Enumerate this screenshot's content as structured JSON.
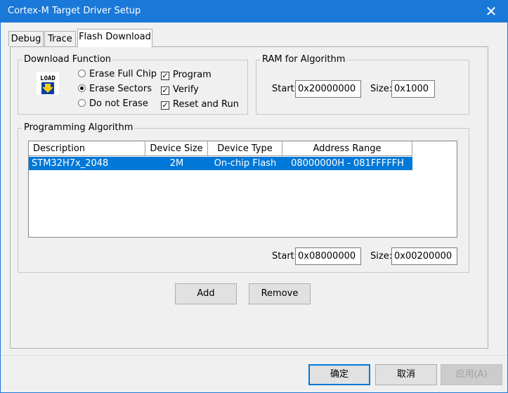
{
  "window": {
    "title": "Cortex-M Target Driver Setup",
    "close_glyph": "✕"
  },
  "tabs": [
    {
      "label": "Debug"
    },
    {
      "label": "Trace"
    },
    {
      "label": "Flash Download"
    }
  ],
  "download_function": {
    "label": "Download Function",
    "icon_text": "LOAD",
    "erase_options": [
      {
        "label": "Erase Full Chip",
        "checked": false
      },
      {
        "label": "Erase Sectors",
        "checked": true
      },
      {
        "label": "Do not Erase",
        "checked": false
      }
    ],
    "checkboxes": [
      {
        "label": "Program",
        "checked": true
      },
      {
        "label": "Verify",
        "checked": true
      },
      {
        "label": "Reset and Run",
        "checked": true
      }
    ]
  },
  "ram": {
    "label": "RAM for Algorithm",
    "start_label": "Start:",
    "start_value": "0x20000000",
    "size_label": "Size:",
    "size_value": "0x1000"
  },
  "programming_algorithm": {
    "label": "Programming Algorithm",
    "columns": [
      "Description",
      "Device Size",
      "Device Type",
      "Address Range"
    ],
    "rows": [
      {
        "description": "STM32H7x_2048",
        "device_size": "2M",
        "device_type": "On-chip Flash",
        "address_range": "08000000H - 081FFFFFH"
      }
    ],
    "start_label": "Start:",
    "start_value": "0x08000000",
    "size_label": "Size:",
    "size_value": "0x00200000"
  },
  "buttons": {
    "add": "Add",
    "remove": "Remove"
  },
  "footer": {
    "ok": "确定",
    "cancel": "取消",
    "apply": "应用(A)"
  },
  "colors": {
    "titlebar": "#1a78d8",
    "selection": "#0078d7"
  }
}
